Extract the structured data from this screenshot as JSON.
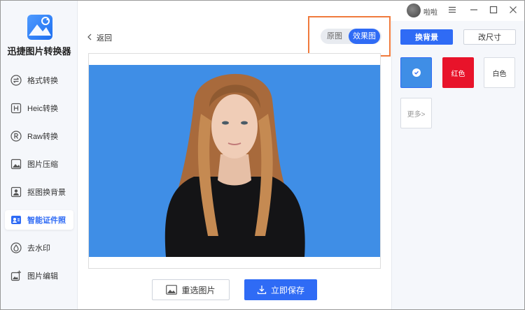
{
  "app": {
    "name": "迅捷图片转换器"
  },
  "sidebar": {
    "items": [
      {
        "label": "格式转换",
        "icon": "convert-icon"
      },
      {
        "label": "Heic转换",
        "icon": "heic-icon"
      },
      {
        "label": "Raw转换",
        "icon": "raw-icon"
      },
      {
        "label": "图片压缩",
        "icon": "compress-icon"
      },
      {
        "label": "抠图换背景",
        "icon": "cutout-icon"
      },
      {
        "label": "智能证件照",
        "icon": "id-photo-icon",
        "active": true
      },
      {
        "label": "去水印",
        "icon": "watermark-icon"
      },
      {
        "label": "图片编辑",
        "icon": "edit-image-icon"
      }
    ]
  },
  "titlebar": {
    "username": "啦啦"
  },
  "main": {
    "back_label": "返回",
    "toggle": {
      "original": "原图",
      "effect": "效果图",
      "selected": "effect"
    },
    "reselect_label": "重选图片",
    "save_label": "立即保存"
  },
  "right_panel": {
    "tab_background": "换背景",
    "tab_size": "改尺寸",
    "swatches": [
      {
        "label": "",
        "color": "#3f8ee6",
        "selected": true
      },
      {
        "label": "红色",
        "color": "#e8132a"
      },
      {
        "label": "白色",
        "color": "#ffffff"
      }
    ],
    "more_label": "更多>"
  },
  "colors": {
    "accent": "#2f6bf5",
    "photo_bg": "#3f8ee6",
    "highlight": "#f07a3c"
  }
}
